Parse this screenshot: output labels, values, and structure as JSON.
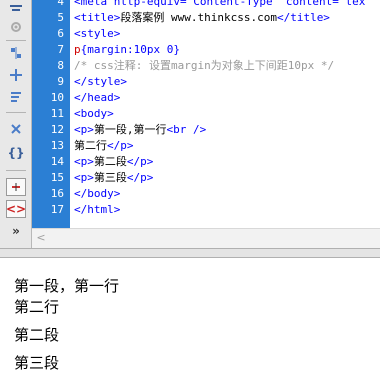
{
  "toolbar": {
    "icons": [
      "collapse-icon",
      "settings-icon",
      "split-icon",
      "expand-icon",
      "wrap-icon",
      "format-icon",
      "braces-icon",
      "highlight-icon",
      "tag-icon",
      "more-icon"
    ]
  },
  "editor": {
    "lines": [
      {
        "num": "4",
        "segs": [
          {
            "t": "<meta http-equiv=\"Content-Type\" content=\"tex",
            "c": "tag"
          }
        ]
      },
      {
        "num": "5",
        "segs": [
          {
            "t": "<title>",
            "c": "tag"
          },
          {
            "t": "段落案例 www.thinkcss.com",
            "c": "text"
          },
          {
            "t": "</title>",
            "c": "tag"
          }
        ]
      },
      {
        "num": "6",
        "segs": [
          {
            "t": "<style>",
            "c": "tag"
          }
        ]
      },
      {
        "num": "7",
        "segs": [
          {
            "t": "p",
            "c": "sel"
          },
          {
            "t": "{margin:10px 0}",
            "c": "tag"
          }
        ]
      },
      {
        "num": "8",
        "segs": [
          {
            "t": "/* css注释: 设置margin为对象上下间距10px */",
            "c": "comment"
          }
        ]
      },
      {
        "num": "9",
        "segs": [
          {
            "t": "</style>",
            "c": "tag"
          }
        ]
      },
      {
        "num": "10",
        "segs": [
          {
            "t": "</head>",
            "c": "tag"
          }
        ]
      },
      {
        "num": "11",
        "segs": [
          {
            "t": "<body>",
            "c": "tag"
          }
        ]
      },
      {
        "num": "12",
        "segs": [
          {
            "t": "<p>",
            "c": "tag"
          },
          {
            "t": "第一段,第一行",
            "c": "text"
          },
          {
            "t": "<br />",
            "c": "tag"
          }
        ]
      },
      {
        "num": "13",
        "segs": [
          {
            "t": "第二行",
            "c": "text"
          },
          {
            "t": "</p>",
            "c": "tag"
          }
        ]
      },
      {
        "num": "14",
        "segs": [
          {
            "t": "<p>",
            "c": "tag"
          },
          {
            "t": "第二段",
            "c": "text"
          },
          {
            "t": "</p>",
            "c": "tag"
          }
        ]
      },
      {
        "num": "15",
        "segs": [
          {
            "t": "<p>",
            "c": "tag"
          },
          {
            "t": "第三段",
            "c": "text"
          },
          {
            "t": "</p>",
            "c": "tag"
          }
        ]
      },
      {
        "num": "16",
        "segs": [
          {
            "t": "</body>",
            "c": "tag"
          }
        ]
      },
      {
        "num": "17",
        "segs": [
          {
            "t": "</html>",
            "c": "tag"
          }
        ]
      }
    ]
  },
  "preview": {
    "p1_line1": "第一段，第一行",
    "p1_line2": "第二行",
    "p2": "第二段",
    "p3": "第三段"
  }
}
